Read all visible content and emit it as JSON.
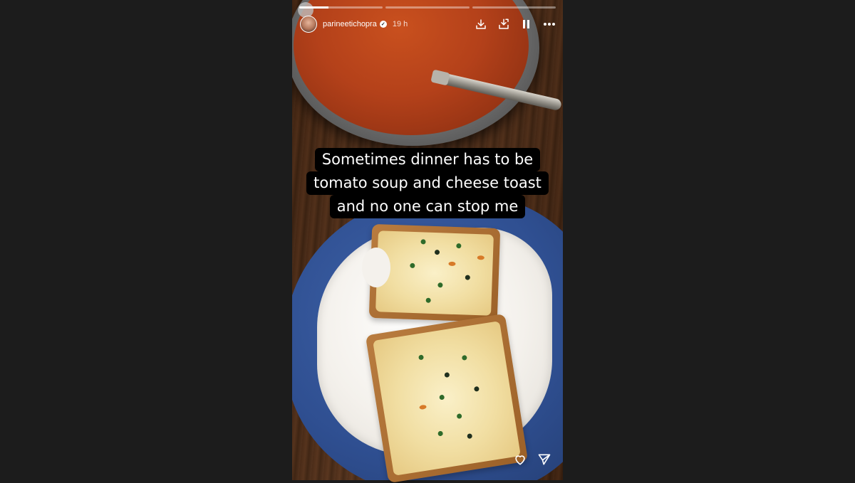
{
  "story": {
    "username": "parineetichopra",
    "time": "19 h",
    "progress": [
      0.35,
      0,
      0
    ],
    "caption": [
      "Sometimes dinner has to be",
      "tomato soup and cheese toast",
      "and no one can stop me"
    ]
  },
  "icons": {
    "download": "download-icon",
    "save": "save-to-device-icon",
    "pause": "pause-icon",
    "more": "more-options-icon",
    "like": "heart-icon",
    "share": "send-icon"
  },
  "colors": {
    "page_bg": "#1c1c1c",
    "caption_bg": "#000000",
    "text": "#ffffff"
  }
}
